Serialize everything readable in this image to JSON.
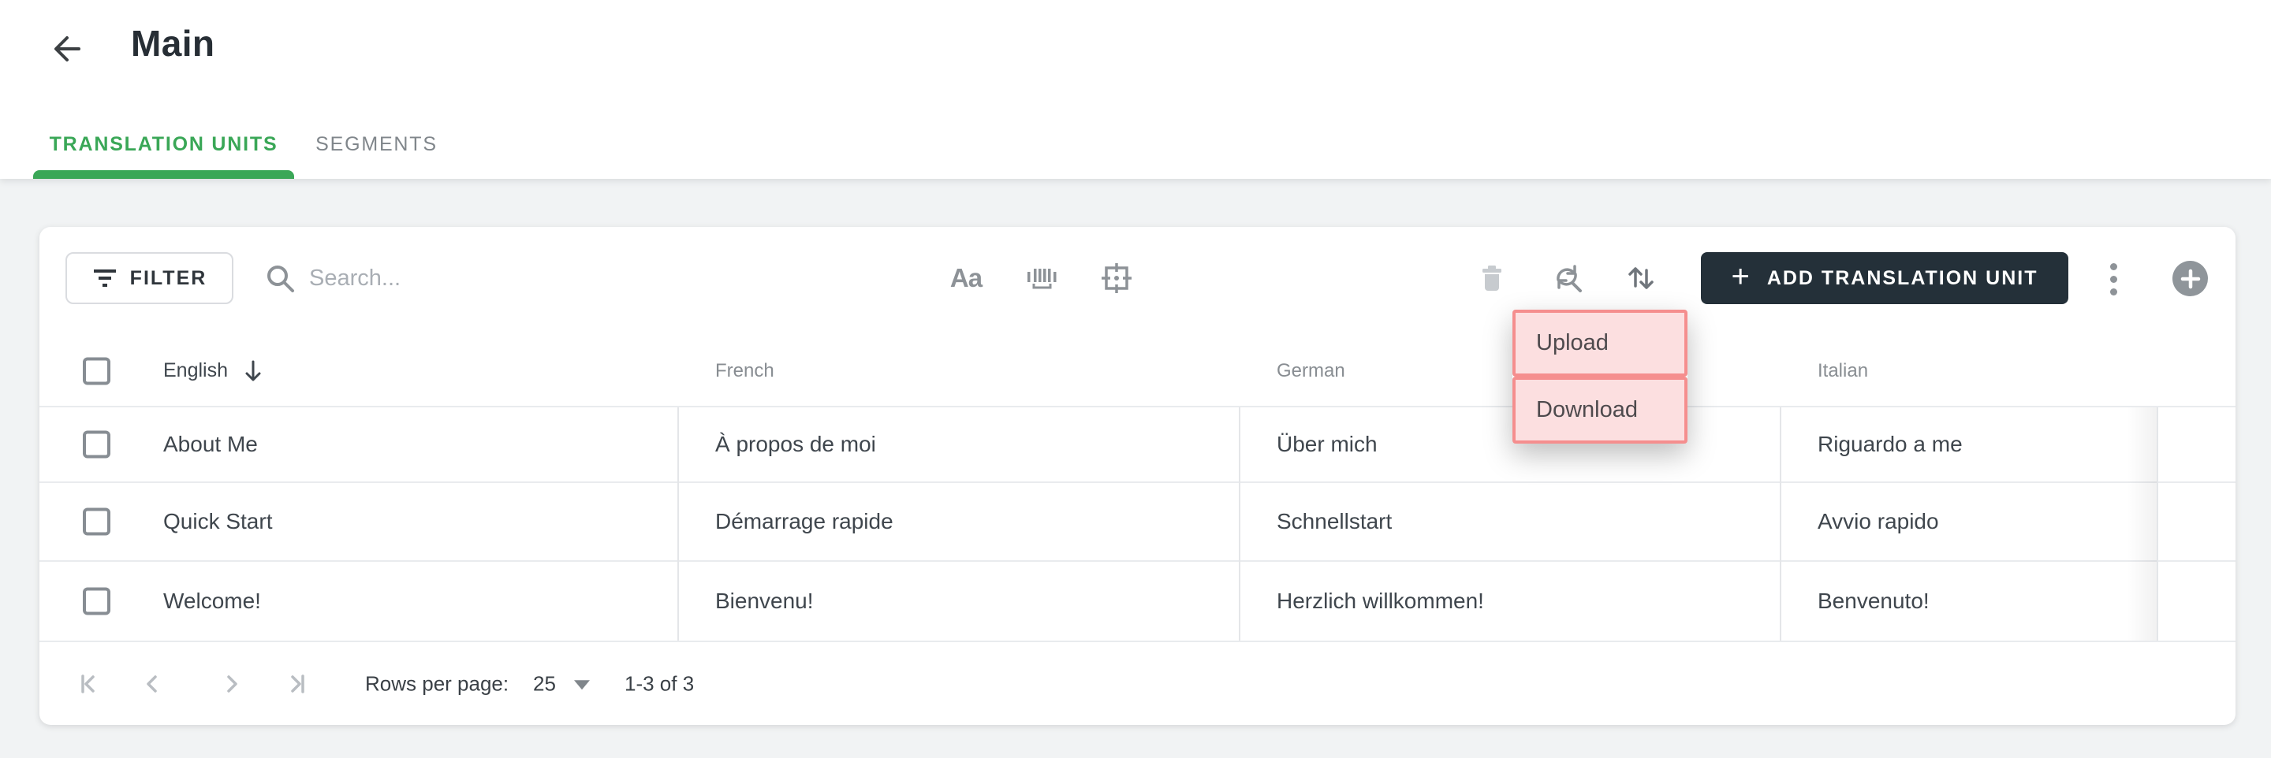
{
  "header": {
    "title": "Main"
  },
  "tabs": [
    {
      "label": "TRANSLATION UNITS",
      "active": true
    },
    {
      "label": "SEGMENTS",
      "active": false
    }
  ],
  "toolbar": {
    "filter_label": "FILTER",
    "search_placeholder": "Search...",
    "match_case_glyph": "Aa",
    "add_button_plus": "+",
    "add_button_label": "ADD TRANSLATION UNIT",
    "icons": [
      "filter-icon",
      "search-icon",
      "match-case-icon",
      "barcode-icon",
      "focus-frame-icon",
      "trash-icon",
      "refresh-search-icon",
      "import-export-icon",
      "more-vert-icon",
      "add-circle-icon"
    ]
  },
  "menu": {
    "items": [
      {
        "label": "Upload"
      },
      {
        "label": "Download"
      }
    ]
  },
  "table": {
    "columns": [
      {
        "label": "English",
        "sort": "desc"
      },
      {
        "label": "French",
        "sort": null
      },
      {
        "label": "German",
        "sort": null
      },
      {
        "label": "Italian",
        "sort": null
      }
    ],
    "rows": [
      {
        "checked": false,
        "cells": [
          "About Me",
          "À propos de moi",
          "Über mich",
          "Riguardo a me"
        ]
      },
      {
        "checked": false,
        "cells": [
          "Quick Start",
          "Démarrage rapide",
          "Schnellstart",
          "Avvio rapido"
        ]
      },
      {
        "checked": false,
        "cells": [
          "Welcome!",
          "Bienvenu!",
          "Herzlich willkommen!",
          "Benvenuto!"
        ]
      }
    ]
  },
  "footer": {
    "rows_per_page_label": "Rows per page:",
    "rows_per_page_value": "25",
    "range_label": "1-3 of 3"
  },
  "colors": {
    "accent_green": "#3aa757",
    "dark_button_bg": "#243039",
    "page_bg": "#f1f3f4",
    "menu_highlight_bg": "#fcdfe0",
    "menu_highlight_border": "#f58e8e"
  }
}
